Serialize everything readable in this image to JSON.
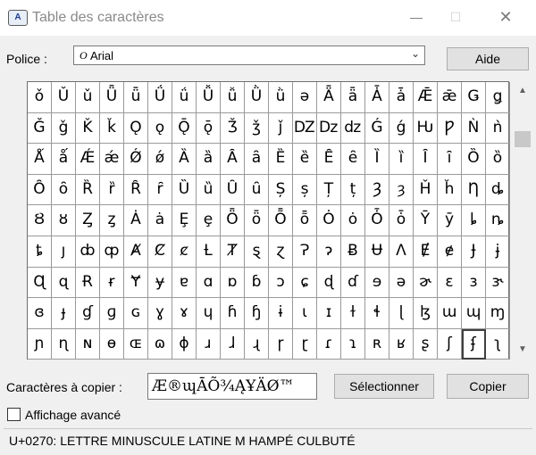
{
  "window": {
    "title": "Table des caractères",
    "minimize": "—",
    "maximize": "☐",
    "close": "✕"
  },
  "font": {
    "label": "Police :",
    "selected": "Arial",
    "font_icon": "O"
  },
  "buttons": {
    "help": "Aide",
    "select": "Sélectionner",
    "copy": "Copier"
  },
  "grid": {
    "selected_index": 178,
    "rows": [
      [
        "ǒ",
        "Ǔ",
        "ǔ",
        "Ǖ",
        "ǖ",
        "Ǘ",
        "ǘ",
        "Ǚ",
        "ǚ",
        "Ǜ",
        "ǜ",
        "ǝ",
        "Ǟ",
        "ǟ",
        "Ǡ",
        "ǡ",
        "Ǣ",
        "ǣ",
        "Ǥ",
        "ǥ"
      ],
      [
        "Ǧ",
        "ǧ",
        "Ǩ",
        "ǩ",
        "Ǫ",
        "ǫ",
        "Ǭ",
        "ǭ",
        "Ǯ",
        "ǯ",
        "ǰ",
        "Ǳ",
        "ǲ",
        "ǳ",
        "Ǵ",
        "ǵ",
        "Ƕ",
        "Ƿ",
        "Ǹ",
        "ǹ"
      ],
      [
        "Ǻ",
        "ǻ",
        "Ǽ",
        "ǽ",
        "Ǿ",
        "ǿ",
        "Ȁ",
        "ȁ",
        "Ȃ",
        "ȃ",
        "Ȅ",
        "ȅ",
        "Ȇ",
        "ȇ",
        "Ȉ",
        "ȉ",
        "Ȋ",
        "ȋ",
        "Ȍ",
        "ȍ"
      ],
      [
        "Ȏ",
        "ȏ",
        "Ȑ",
        "ȑ",
        "Ȓ",
        "ȓ",
        "Ȕ",
        "ȕ",
        "Ȗ",
        "ȗ",
        "Ș",
        "ș",
        "Ț",
        "ț",
        "Ȝ",
        "ȝ",
        "Ȟ",
        "ȟ",
        "Ƞ",
        "ȡ"
      ],
      [
        "Ȣ",
        "ȣ",
        "Ȥ",
        "ȥ",
        "Ȧ",
        "ȧ",
        "Ȩ",
        "ȩ",
        "Ȫ",
        "ȫ",
        "Ȭ",
        "ȭ",
        "Ȯ",
        "ȯ",
        "Ȱ",
        "ȱ",
        "Ȳ",
        "ȳ",
        "ȴ",
        "ȵ"
      ],
      [
        "ȶ",
        "ȷ",
        "ȸ",
        "ȹ",
        "Ⱥ",
        "Ȼ",
        "ȼ",
        "Ƚ",
        "Ⱦ",
        "ȿ",
        "ɀ",
        "Ɂ",
        "ɂ",
        "Ƀ",
        "Ʉ",
        "Ʌ",
        "Ɇ",
        "ɇ",
        "Ɉ",
        "ɉ"
      ],
      [
        "Ɋ",
        "ɋ",
        "Ɍ",
        "ɍ",
        "Ɏ",
        "ɏ",
        "ɐ",
        "ɑ",
        "ɒ",
        "ɓ",
        "ɔ",
        "ɕ",
        "ɖ",
        "ɗ",
        "ɘ",
        "ə",
        "ɚ",
        "ɛ",
        "ɜ",
        "ɝ"
      ],
      [
        "ɞ",
        "ɟ",
        "ɠ",
        "ɡ",
        "ɢ",
        "ɣ",
        "ɤ",
        "ɥ",
        "ɦ",
        "ɧ",
        "ɨ",
        "ɩ",
        "ɪ",
        "ɫ",
        "ɬ",
        "ɭ",
        "ɮ",
        "ɯ",
        "ɰ",
        "ɱ"
      ],
      [
        "ɲ",
        "ɳ",
        "ɴ",
        "ɵ",
        "ɶ",
        "ɷ",
        "ɸ",
        "ɹ",
        "ɺ",
        "ɻ",
        "ɼ",
        "ɽ",
        "ɾ",
        "ɿ",
        "ʀ",
        "ʁ",
        "ʂ",
        "ʃ",
        "ʄ",
        "ʅ"
      ]
    ]
  },
  "copy": {
    "label": "Caractères à copier :",
    "value": "Æ®ɰĀÕ¾ĄҰÄØ™"
  },
  "advanced": {
    "label": "Affichage avancé",
    "checked": false
  },
  "status": "U+0270: LETTRE MINUSCULE LATINE M HAMPÉ CULBUTÉ",
  "scrollbar": {
    "up": "▲",
    "down": "▼"
  }
}
